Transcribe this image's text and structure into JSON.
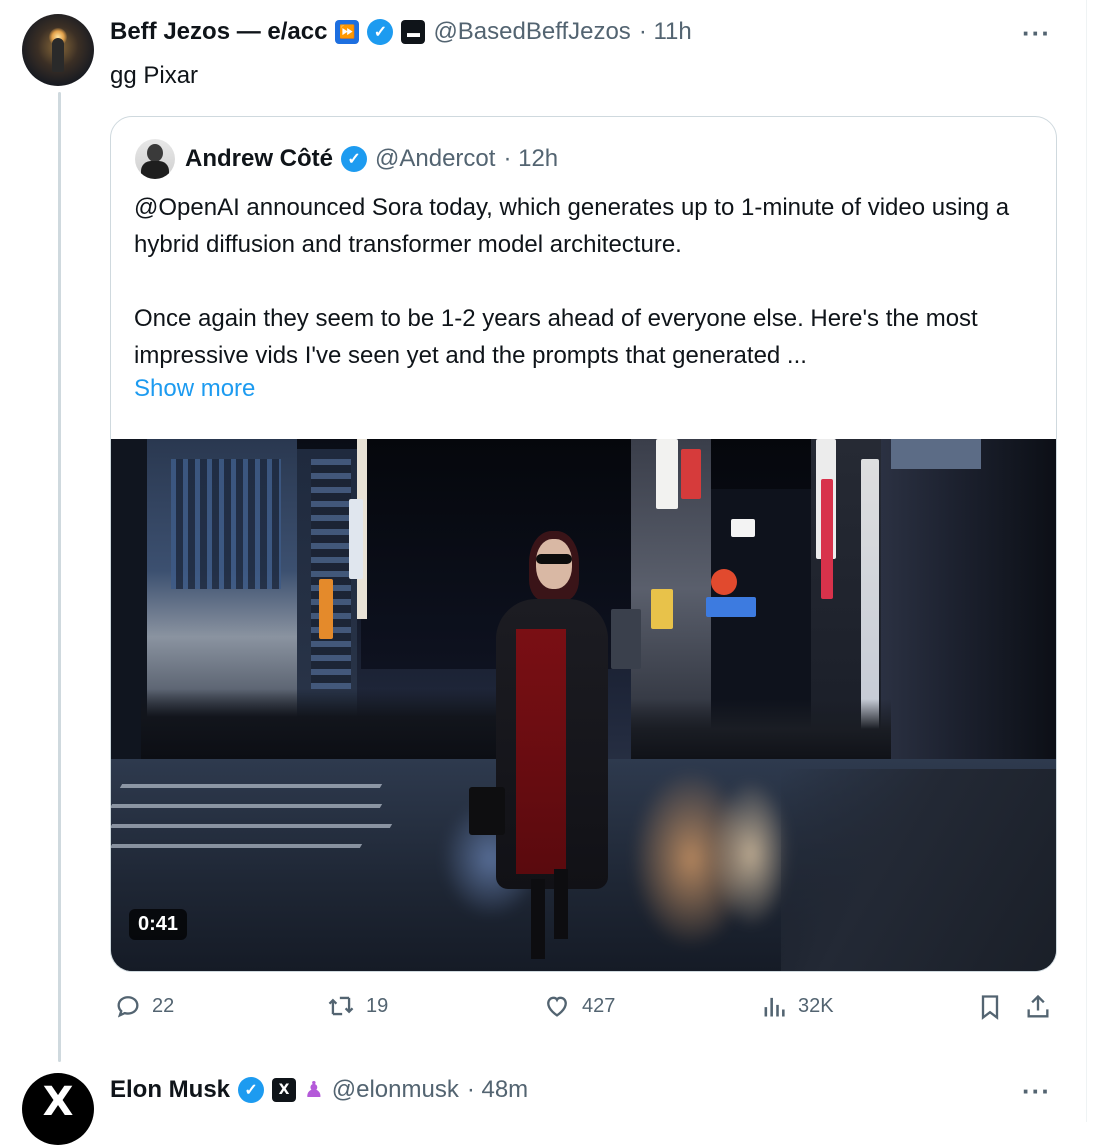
{
  "colors": {
    "accent": "#1d9bf0",
    "muted": "#536471",
    "text": "#0f1419",
    "border": "#cfd9de"
  },
  "tweet": {
    "author_name": "Beff Jezos — e/acc",
    "handle": "@BasedBeffJezos",
    "time": "· 11h",
    "text": "gg Pixar",
    "more_label": "···"
  },
  "quote": {
    "author_name": "Andrew Côté",
    "handle": "@Andercot",
    "time": "· 12h",
    "paragraph1": "@OpenAI announced Sora today, which generates up to 1-minute of video using a hybrid diffusion and transformer model architecture.",
    "paragraph2": "Once again they seem to be 1-2 years ahead of everyone else. Here's the most impressive vids I've seen yet and the prompts that generated ...",
    "show_more": "Show more",
    "video_duration": "0:41"
  },
  "actions": {
    "replies": "22",
    "reposts": "19",
    "likes": "427",
    "views": "32K",
    "icons": [
      "reply-icon",
      "repost-icon",
      "like-icon",
      "views-icon",
      "bookmark-icon",
      "share-icon"
    ]
  },
  "next_tweet": {
    "author_name": "Elon Musk",
    "handle": "@elonmusk",
    "time": "· 48m",
    "avatar_glyph": "X",
    "more_label": "···"
  }
}
